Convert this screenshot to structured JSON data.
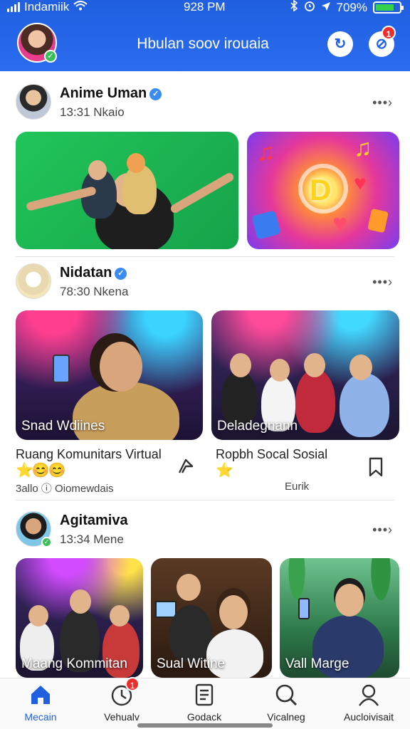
{
  "status_bar": {
    "carrier": "Indamiik",
    "time": "928 PM",
    "battery": "709%"
  },
  "header": {
    "title": "Hbulan soov irouaia",
    "notification_count": "1"
  },
  "posts": [
    {
      "author": "Anime Uman",
      "meta": "13:31 Nkaio",
      "tiles": [
        {
          "label": ""
        },
        {
          "label": ""
        }
      ]
    },
    {
      "author": "Nidatan",
      "meta": "78:30 Nkena",
      "tiles": [
        {
          "label": "Snad Wdiines"
        },
        {
          "label": "Deladegnann"
        }
      ],
      "captions": [
        {
          "title": "Ruang Komunitars Virtual",
          "emojis": "⭐😊😊",
          "footnote": "3allo ⓘ Oiomewdais"
        },
        {
          "title": "Ropbh Socal Sosial",
          "emojis": "⭐",
          "footnote": "Eurik"
        }
      ]
    },
    {
      "author": "Agitamiva",
      "meta": "13:34 Mene",
      "tiles": [
        {
          "label": "Maang Kommitan"
        },
        {
          "label": "Sual Witine"
        },
        {
          "label": "Vall Marge"
        }
      ]
    }
  ],
  "bottom_nav": [
    {
      "label": "Mecain",
      "icon": "home-icon",
      "active": true
    },
    {
      "label": "Vehualv",
      "icon": "timer-icon",
      "badge": "1"
    },
    {
      "label": "Godack",
      "icon": "document-icon"
    },
    {
      "label": "Vicalneg",
      "icon": "search-icon"
    },
    {
      "label": "Aucloivisait",
      "icon": "profile-icon"
    }
  ],
  "colors": {
    "brand": "#1f5fe0",
    "badge": "#f02d2d",
    "online": "#3bbf5a",
    "verified": "#3b8cf2"
  }
}
